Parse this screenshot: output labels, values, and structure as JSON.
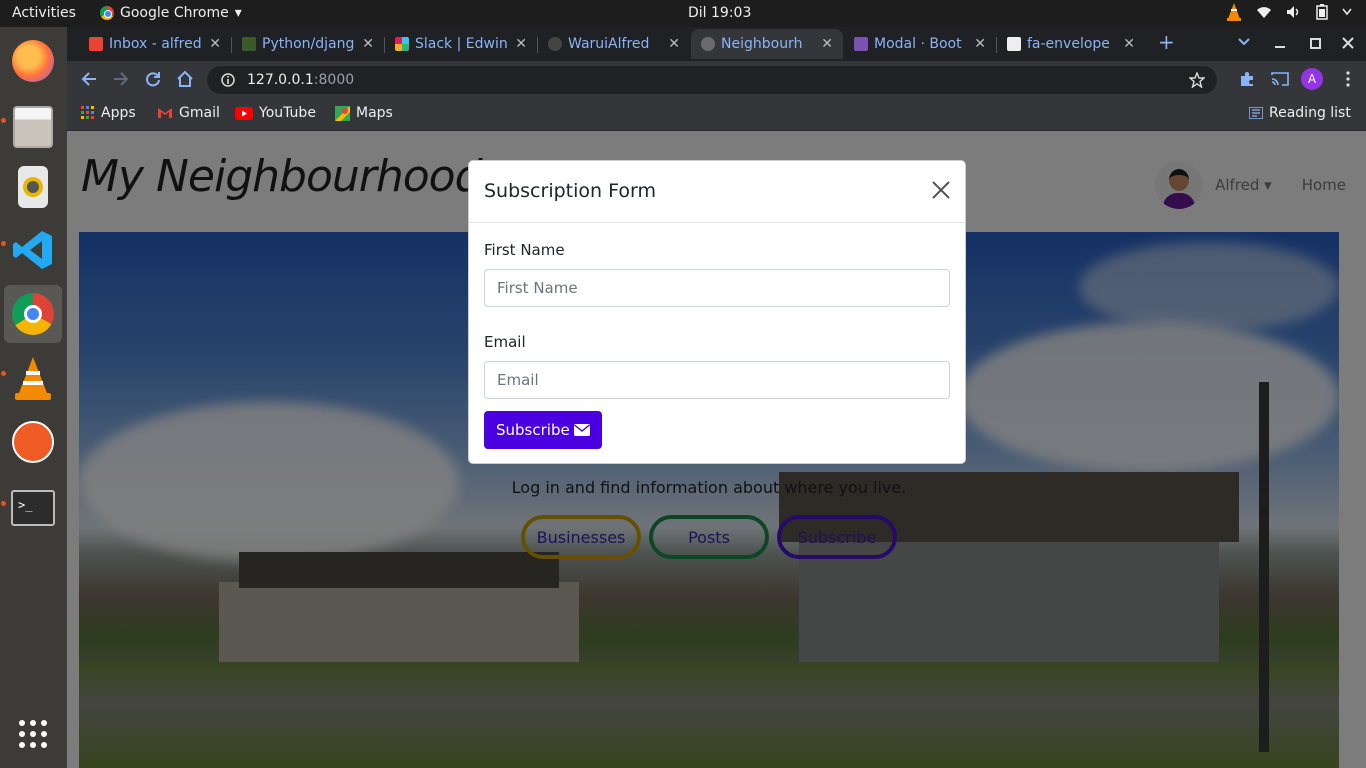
{
  "system": {
    "activities_label": "Activities",
    "app_menu_label": "Google Chrome",
    "app_menu_arrow": "▾",
    "clock": "Dil 19:03"
  },
  "dock": {
    "items": [
      "firefox",
      "files",
      "rhythmbox",
      "vscode",
      "chrome",
      "vlc",
      "postman",
      "terminal"
    ],
    "apps_grid_icon": "apps-grid-icon"
  },
  "browser": {
    "tabs": [
      {
        "label": "Inbox - alfred",
        "favicon_color": "#ea4335"
      },
      {
        "label": "Python/djang",
        "favicon_color": "#3b5a2a"
      },
      {
        "label": "Slack | Edwin",
        "favicon_color": "#e01e5a"
      },
      {
        "label": "WaruiAlfred",
        "favicon_color": "#444444"
      },
      {
        "label": "Neighbourh",
        "favicon_color": "#6b6b6b"
      },
      {
        "label": "Modal · Boot",
        "favicon_color": "#7952b3"
      },
      {
        "label": "fa-envelope",
        "favicon_color": "#eeeeee"
      }
    ],
    "active_tab_index": 4,
    "tab_close_glyph": "✕",
    "new_tab_glyph": "+",
    "url_host": "127.0.0.1",
    "url_port": ":8000",
    "avatar_letter": "A",
    "bookmarks": [
      {
        "label": "Apps",
        "color": "#4285f4"
      },
      {
        "label": "Gmail",
        "color": "#ea4335"
      },
      {
        "label": "YouTube",
        "color": "#ff0000"
      },
      {
        "label": "Maps",
        "color": "#34a853"
      }
    ],
    "reading_list_label": "Reading list"
  },
  "site": {
    "title": "My Neighbourhood",
    "user_name": "Alfred",
    "home_link": "Home",
    "hero_text": "Log in and find information about where you live.",
    "buttons": {
      "businesses": "Businesses",
      "posts": "Posts",
      "subscribe": "Subscribe"
    }
  },
  "modal": {
    "title": "Subscription Form",
    "close_glyph": "×",
    "first_name_label": "First Name",
    "first_name_placeholder": "First Name",
    "first_name_value": "",
    "email_label": "Email",
    "email_placeholder": "Email",
    "email_value": "",
    "submit_label": "Subscribe",
    "submit_icon": "envelope-icon",
    "submit_color": "#4a00e0"
  }
}
